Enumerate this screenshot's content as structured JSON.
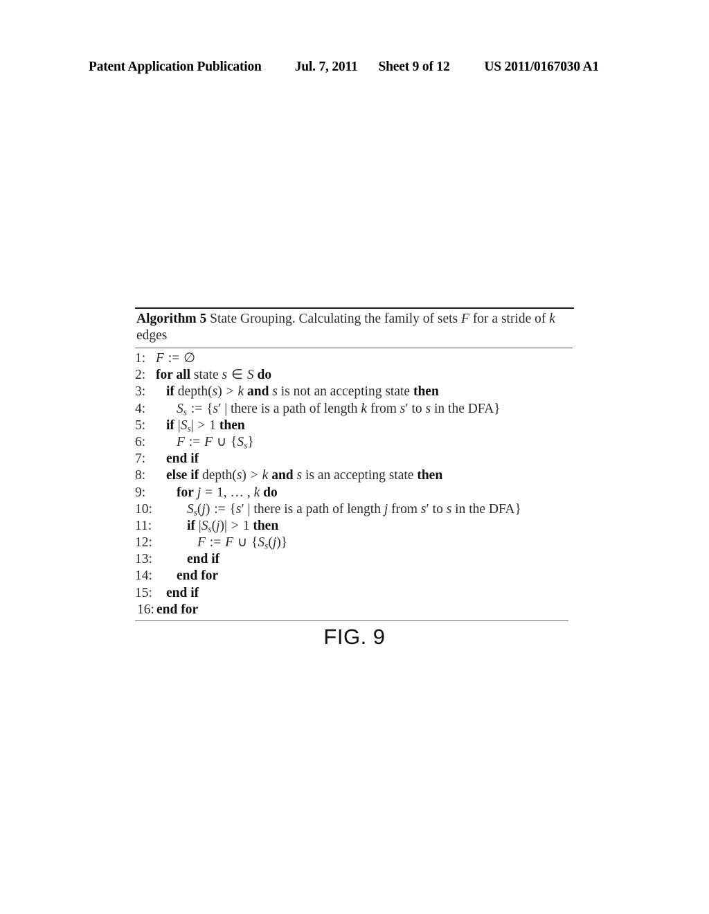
{
  "header": {
    "publication": "Patent Application Publication",
    "date": "Jul. 7, 2011",
    "sheet": "Sheet 9 of 12",
    "number": "US 2011/0167030 A1"
  },
  "algorithm": {
    "label": "Algorithm 5",
    "caption": "State Grouping. Calculating the family of sets F for a stride of k edges",
    "caption_line1": "State Grouping. Calculating the family of sets F for a stride",
    "caption_line2": "of k edges",
    "lines": [
      {
        "n": "1:",
        "indent": 0,
        "text": "F := ∅"
      },
      {
        "n": "2:",
        "indent": 0,
        "text": "for all state s ∈ S do"
      },
      {
        "n": "3:",
        "indent": 1,
        "text": "if depth(s) > k and s is not an accepting state then"
      },
      {
        "n": "4:",
        "indent": 2,
        "text": "Sₛ := {s′ | there is a path of length k from s′ to s in the DFA}"
      },
      {
        "n": "5:",
        "indent": 1,
        "text": "if |Sₛ| > 1 then"
      },
      {
        "n": "6:",
        "indent": 2,
        "text": "F := F ∪ {Sₛ}"
      },
      {
        "n": "7:",
        "indent": 1,
        "text": "end if"
      },
      {
        "n": "8:",
        "indent": 1,
        "text": "else if depth(s) > k and s is an accepting state then"
      },
      {
        "n": "9:",
        "indent": 2,
        "text": "for j = 1, … , k do"
      },
      {
        "n": "10:",
        "indent": 3,
        "text": "Sₛ(j) := {s′ | there is a path of length j from s′ to s in the DFA}"
      },
      {
        "n": "11:",
        "indent": 3,
        "text": "if |Sₛ(j)| > 1 then"
      },
      {
        "n": "12:",
        "indent": 4,
        "text": "F := F ∪ {Sₛ(j)}"
      },
      {
        "n": "13:",
        "indent": 3,
        "text": "end if"
      },
      {
        "n": "14:",
        "indent": 2,
        "text": "end for"
      },
      {
        "n": "15:",
        "indent": 1,
        "text": "end if"
      },
      {
        "n": "16:",
        "indent": 0,
        "text": "end for"
      }
    ]
  },
  "figure": {
    "caption": "FIG. 9"
  }
}
